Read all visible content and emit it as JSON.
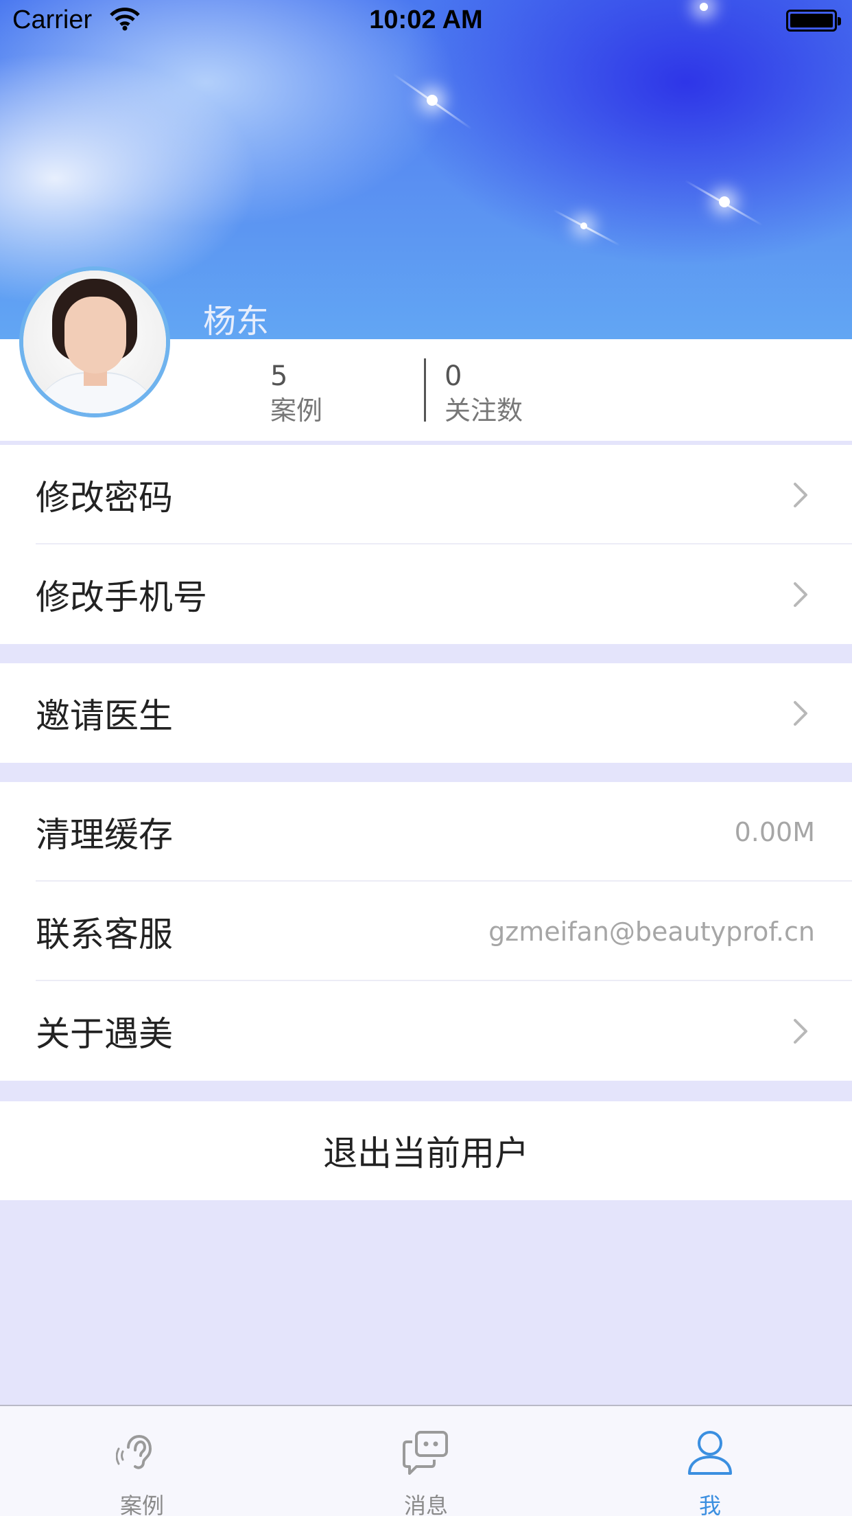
{
  "status_bar": {
    "carrier": "Carrier",
    "time": "10:02 AM"
  },
  "profile": {
    "name": "杨东",
    "stats": [
      {
        "value": "5",
        "label": "案例"
      },
      {
        "value": "0",
        "label": "关注数"
      }
    ]
  },
  "menu": {
    "change_password": "修改密码",
    "change_phone": "修改手机号",
    "invite_doctor": "邀请医生",
    "clear_cache": "清理缓存",
    "cache_size": "0.00M",
    "contact_support": "联系客服",
    "support_email": "gzmeifan@beautyprof.cn",
    "about": "关于遇美",
    "logout": "退出当前用户"
  },
  "tabs": [
    {
      "label": "案例",
      "icon": "ear-icon",
      "active": false
    },
    {
      "label": "消息",
      "icon": "chat-bubble-icon",
      "active": false
    },
    {
      "label": "我",
      "icon": "person-icon",
      "active": true
    }
  ],
  "colors": {
    "accent": "#3b8fe0",
    "page_background": "#e4e4fb",
    "avatar_ring": "#6fb3ee"
  }
}
